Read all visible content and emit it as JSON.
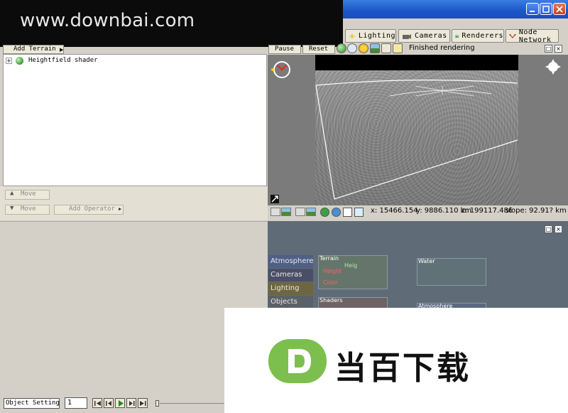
{
  "watermark": {
    "text": "www.downbai.com"
  },
  "window": {
    "controls": [
      "minimize",
      "maximize",
      "close"
    ]
  },
  "tabs": [
    {
      "label": "Lighting",
      "icon": "sun-icon"
    },
    {
      "label": "Cameras",
      "icon": "camera-icon"
    },
    {
      "label": "Renderers",
      "icon": "landscape-icon"
    },
    {
      "label": "Node Network",
      "icon": "node-icon"
    }
  ],
  "left": {
    "add_terrain": "Add Terrain",
    "tree_items": [
      {
        "label": "Heightfield shader"
      }
    ],
    "move_up": "Move",
    "move_down": "Move",
    "add_operator": "Add Operator"
  },
  "render": {
    "pause": "Pause",
    "reset": "Reset",
    "status": "Finished rendering"
  },
  "coords": {
    "x": "x: 15466.154",
    "y": "y: 9886.110 km",
    "z": "z: 199117.486",
    "slope": "slope: 92.91? km"
  },
  "node_network": {
    "categories": [
      {
        "label": "Atmosphere",
        "color": "#4f5f85"
      },
      {
        "label": "Cameras",
        "color": "#4a4f66"
      },
      {
        "label": "Lighting",
        "color": "#6d6640"
      },
      {
        "label": "Objects",
        "color": "#5b6168"
      }
    ],
    "nodes": {
      "terrain": "Terrain",
      "height_port": "Height",
      "color_port": "Color",
      "heightfield": "Heig",
      "shaders": "Shaders",
      "water": "Water",
      "atmosphere": "Atmosphere"
    }
  },
  "bottom": {
    "object_settings": "Object Settings",
    "frame": "1"
  },
  "logo": {
    "text": "当百下载",
    "color": "#7cbf4f"
  }
}
